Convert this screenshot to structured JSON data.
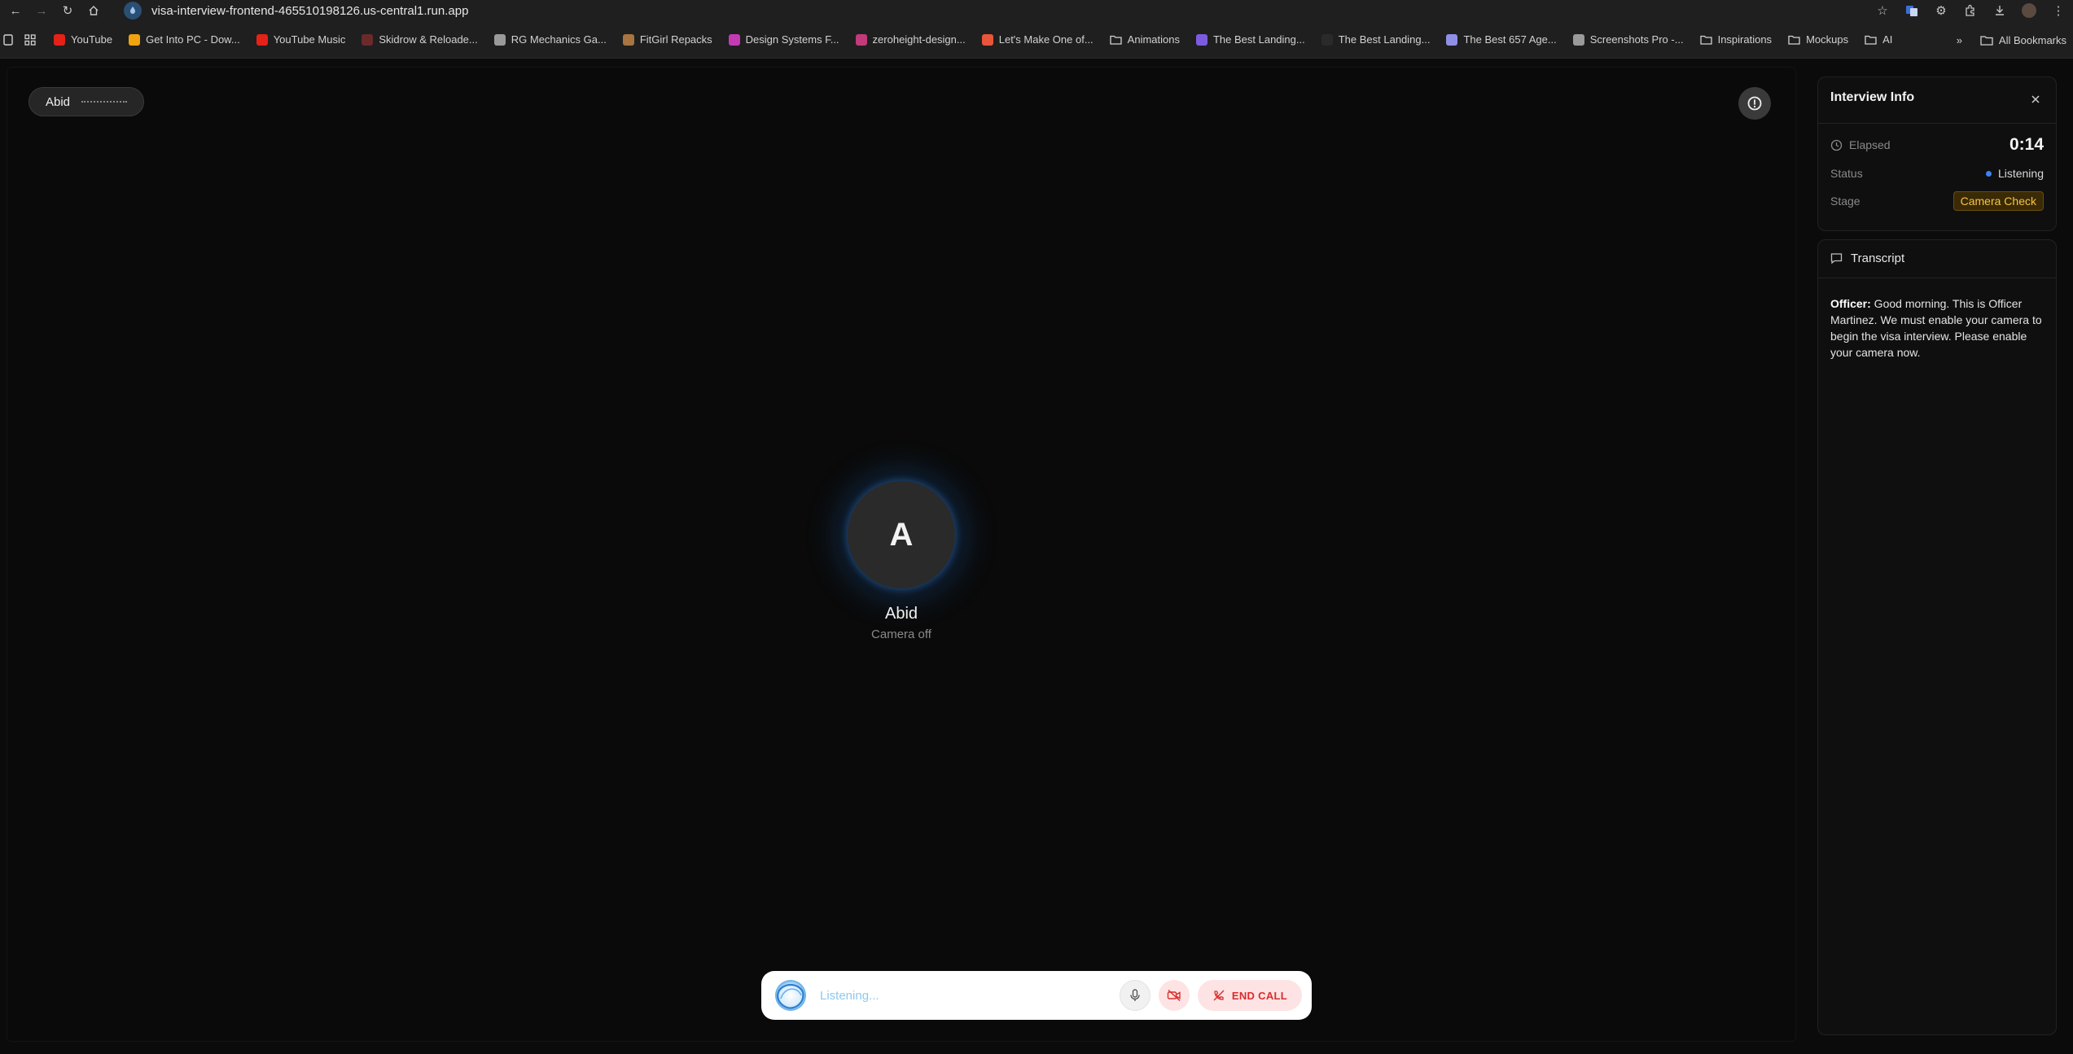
{
  "browser": {
    "url": "visa-interview-frontend-465510198126.us-central1.run.app",
    "bookmarks": [
      {
        "label": "YouTube",
        "color": "#e62117"
      },
      {
        "label": "Get Into PC - Dow...",
        "color": "#f2a20f"
      },
      {
        "label": "YouTube Music",
        "color": "#e62117"
      },
      {
        "label": "Skidrow & Reloade...",
        "color": "#6b2a2a"
      },
      {
        "label": "RG Mechanics Ga...",
        "color": "#9a9a9a"
      },
      {
        "label": "FitGirl Repacks",
        "color": "#a8743f"
      },
      {
        "label": "Design Systems F...",
        "color": "#c43ab5"
      },
      {
        "label": "zeroheight-design...",
        "color": "#c13a7a"
      },
      {
        "label": "Let's Make One of...",
        "color": "#e8553a"
      },
      {
        "label": "Animations",
        "color": "folder"
      },
      {
        "label": "The Best Landing...",
        "color": "#7b5ce0"
      },
      {
        "label": "The Best Landing...",
        "color": "#2a2a2a"
      },
      {
        "label": "The Best 657 Age...",
        "color": "#8f8fe8"
      },
      {
        "label": "Screenshots Pro -...",
        "color": "#9a9a9a"
      },
      {
        "label": "Inspirations",
        "color": "folder"
      },
      {
        "label": "Mockups",
        "color": "folder"
      },
      {
        "label": "AI",
        "color": "folder"
      }
    ],
    "all_bookmarks": "All Bookmarks"
  },
  "call": {
    "user_name": "Abid",
    "avatar_letter": "A",
    "participant_name": "Abid",
    "camera_status": "Camera off",
    "listening_text": "Listening...",
    "end_call_label": "END CALL"
  },
  "info": {
    "title": "Interview Info",
    "elapsed_label": "Elapsed",
    "elapsed_value": "0:14",
    "status_label": "Status",
    "status_value": "Listening",
    "stage_label": "Stage",
    "stage_value": "Camera Check",
    "status_color": "#3b82f6",
    "stage_color": "#f6c343"
  },
  "transcript": {
    "title": "Transcript",
    "entries": [
      {
        "speaker": "Officer:",
        "text": " Good morning. This is Officer Martinez. We must enable your camera to begin the visa interview. Please enable your camera now."
      }
    ]
  }
}
